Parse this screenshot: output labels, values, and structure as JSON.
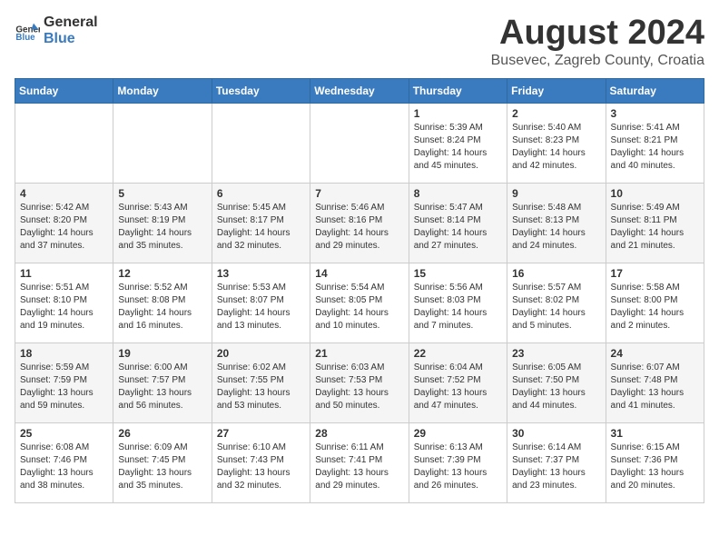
{
  "header": {
    "logo_general": "General",
    "logo_blue": "Blue",
    "month_title": "August 2024",
    "location": "Busevec, Zagreb County, Croatia"
  },
  "weekdays": [
    "Sunday",
    "Monday",
    "Tuesday",
    "Wednesday",
    "Thursday",
    "Friday",
    "Saturday"
  ],
  "weeks": [
    [
      {
        "day": "",
        "info": ""
      },
      {
        "day": "",
        "info": ""
      },
      {
        "day": "",
        "info": ""
      },
      {
        "day": "",
        "info": ""
      },
      {
        "day": "1",
        "info": "Sunrise: 5:39 AM\nSunset: 8:24 PM\nDaylight: 14 hours\nand 45 minutes."
      },
      {
        "day": "2",
        "info": "Sunrise: 5:40 AM\nSunset: 8:23 PM\nDaylight: 14 hours\nand 42 minutes."
      },
      {
        "day": "3",
        "info": "Sunrise: 5:41 AM\nSunset: 8:21 PM\nDaylight: 14 hours\nand 40 minutes."
      }
    ],
    [
      {
        "day": "4",
        "info": "Sunrise: 5:42 AM\nSunset: 8:20 PM\nDaylight: 14 hours\nand 37 minutes."
      },
      {
        "day": "5",
        "info": "Sunrise: 5:43 AM\nSunset: 8:19 PM\nDaylight: 14 hours\nand 35 minutes."
      },
      {
        "day": "6",
        "info": "Sunrise: 5:45 AM\nSunset: 8:17 PM\nDaylight: 14 hours\nand 32 minutes."
      },
      {
        "day": "7",
        "info": "Sunrise: 5:46 AM\nSunset: 8:16 PM\nDaylight: 14 hours\nand 29 minutes."
      },
      {
        "day": "8",
        "info": "Sunrise: 5:47 AM\nSunset: 8:14 PM\nDaylight: 14 hours\nand 27 minutes."
      },
      {
        "day": "9",
        "info": "Sunrise: 5:48 AM\nSunset: 8:13 PM\nDaylight: 14 hours\nand 24 minutes."
      },
      {
        "day": "10",
        "info": "Sunrise: 5:49 AM\nSunset: 8:11 PM\nDaylight: 14 hours\nand 21 minutes."
      }
    ],
    [
      {
        "day": "11",
        "info": "Sunrise: 5:51 AM\nSunset: 8:10 PM\nDaylight: 14 hours\nand 19 minutes."
      },
      {
        "day": "12",
        "info": "Sunrise: 5:52 AM\nSunset: 8:08 PM\nDaylight: 14 hours\nand 16 minutes."
      },
      {
        "day": "13",
        "info": "Sunrise: 5:53 AM\nSunset: 8:07 PM\nDaylight: 14 hours\nand 13 minutes."
      },
      {
        "day": "14",
        "info": "Sunrise: 5:54 AM\nSunset: 8:05 PM\nDaylight: 14 hours\nand 10 minutes."
      },
      {
        "day": "15",
        "info": "Sunrise: 5:56 AM\nSunset: 8:03 PM\nDaylight: 14 hours\nand 7 minutes."
      },
      {
        "day": "16",
        "info": "Sunrise: 5:57 AM\nSunset: 8:02 PM\nDaylight: 14 hours\nand 5 minutes."
      },
      {
        "day": "17",
        "info": "Sunrise: 5:58 AM\nSunset: 8:00 PM\nDaylight: 14 hours\nand 2 minutes."
      }
    ],
    [
      {
        "day": "18",
        "info": "Sunrise: 5:59 AM\nSunset: 7:59 PM\nDaylight: 13 hours\nand 59 minutes."
      },
      {
        "day": "19",
        "info": "Sunrise: 6:00 AM\nSunset: 7:57 PM\nDaylight: 13 hours\nand 56 minutes."
      },
      {
        "day": "20",
        "info": "Sunrise: 6:02 AM\nSunset: 7:55 PM\nDaylight: 13 hours\nand 53 minutes."
      },
      {
        "day": "21",
        "info": "Sunrise: 6:03 AM\nSunset: 7:53 PM\nDaylight: 13 hours\nand 50 minutes."
      },
      {
        "day": "22",
        "info": "Sunrise: 6:04 AM\nSunset: 7:52 PM\nDaylight: 13 hours\nand 47 minutes."
      },
      {
        "day": "23",
        "info": "Sunrise: 6:05 AM\nSunset: 7:50 PM\nDaylight: 13 hours\nand 44 minutes."
      },
      {
        "day": "24",
        "info": "Sunrise: 6:07 AM\nSunset: 7:48 PM\nDaylight: 13 hours\nand 41 minutes."
      }
    ],
    [
      {
        "day": "25",
        "info": "Sunrise: 6:08 AM\nSunset: 7:46 PM\nDaylight: 13 hours\nand 38 minutes."
      },
      {
        "day": "26",
        "info": "Sunrise: 6:09 AM\nSunset: 7:45 PM\nDaylight: 13 hours\nand 35 minutes."
      },
      {
        "day": "27",
        "info": "Sunrise: 6:10 AM\nSunset: 7:43 PM\nDaylight: 13 hours\nand 32 minutes."
      },
      {
        "day": "28",
        "info": "Sunrise: 6:11 AM\nSunset: 7:41 PM\nDaylight: 13 hours\nand 29 minutes."
      },
      {
        "day": "29",
        "info": "Sunrise: 6:13 AM\nSunset: 7:39 PM\nDaylight: 13 hours\nand 26 minutes."
      },
      {
        "day": "30",
        "info": "Sunrise: 6:14 AM\nSunset: 7:37 PM\nDaylight: 13 hours\nand 23 minutes."
      },
      {
        "day": "31",
        "info": "Sunrise: 6:15 AM\nSunset: 7:36 PM\nDaylight: 13 hours\nand 20 minutes."
      }
    ]
  ]
}
